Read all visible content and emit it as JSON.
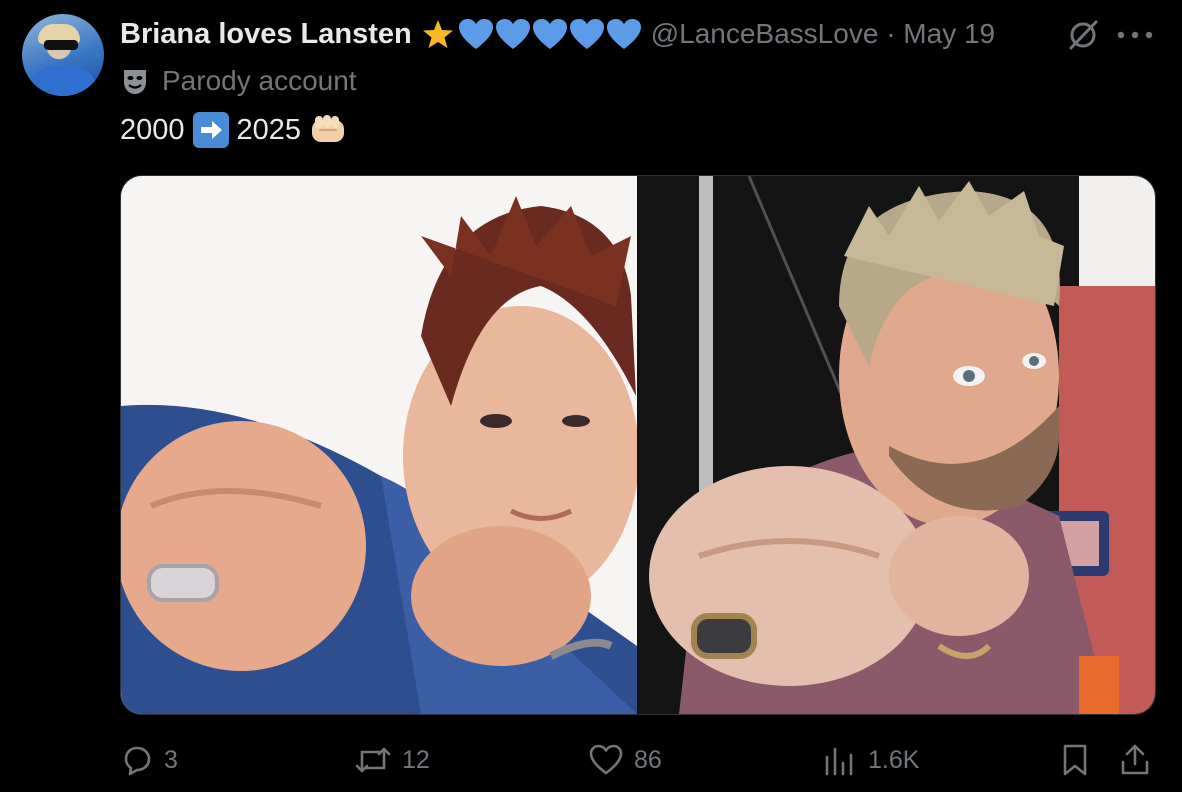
{
  "post": {
    "display_name": "Briana loves Lansten",
    "handle": "@LanceBassLove",
    "separator": "·",
    "date": "May 19",
    "label": "Parody account",
    "text_before": "2000",
    "text_after": "2025",
    "emojis": [
      "star-icon",
      "blue-heart-icon",
      "blue-heart-icon",
      "blue-heart-icon",
      "blue-heart-icon",
      "blue-heart-icon"
    ]
  },
  "media": {
    "left_photo": "photo-2000",
    "right_photo": "photo-2025"
  },
  "actions": {
    "replies": "3",
    "reposts": "12",
    "likes": "86",
    "views": "1.6K"
  },
  "colors": {
    "background": "#000000",
    "text": "#e7e9ea",
    "secondary_text": "#71767b",
    "heart_blue": "#5b9be8",
    "star_yellow": "#f5b922"
  }
}
